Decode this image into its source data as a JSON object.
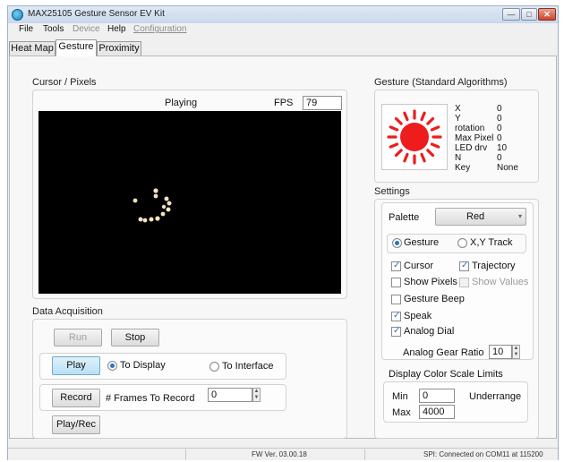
{
  "window": {
    "title": "MAX25105 Gesture Sensor EV Kit",
    "min": "—",
    "max": "□",
    "close": "✕"
  },
  "menu": [
    "File",
    "Tools",
    "Device",
    "Help",
    "Configuration"
  ],
  "tabs": [
    "Heat Map",
    "Gesture",
    "Proximity"
  ],
  "cursor_pixels": {
    "title": "Cursor / Pixels",
    "status": "Playing",
    "fps_label": "FPS",
    "fps_value": "79"
  },
  "gesture": {
    "title": "Gesture (Standard Algorithms)",
    "rows": [
      {
        "label": "X",
        "value": "0"
      },
      {
        "label": "Y",
        "value": "0"
      },
      {
        "label": "rotation",
        "value": "0"
      },
      {
        "label": "Max Pixel",
        "value": "0"
      },
      {
        "label": "LED drv",
        "value": "10"
      },
      {
        "label": "N",
        "value": "0"
      },
      {
        "label": "Key",
        "value": "None"
      }
    ],
    "dial_color": "#ee1c1c"
  },
  "settings": {
    "title": "Settings",
    "palette_label": "Palette",
    "palette_value": "Red",
    "mode_gesture": "Gesture",
    "mode_xy": "X,Y Track",
    "cursor": "Cursor",
    "trajectory": "Trajectory",
    "show_pixels": "Show Pixels",
    "show_values": "Show Values",
    "gesture_beep": "Gesture Beep",
    "speak": "Speak",
    "analog_dial": "Analog Dial",
    "gear_ratio_label": "Analog Gear Ratio",
    "gear_ratio_value": "10"
  },
  "color_limits": {
    "title": "Display Color Scale Limits",
    "min_label": "Min",
    "min_value": "0",
    "max_label": "Max",
    "max_value": "4000",
    "underrange": "Underrange"
  },
  "acquisition": {
    "title": "Data Acquisition",
    "run": "Run",
    "stop": "Stop",
    "play": "Play",
    "to_display": "To Display",
    "to_interface": "To Interface",
    "record": "Record",
    "frames_label": "# Frames To Record",
    "frames_value": "0",
    "play_rec": "Play/Rec"
  },
  "status": {
    "fw": "FW Ver. 03.00.18",
    "conn": "SPI: Connected on COM11 at 115200"
  }
}
